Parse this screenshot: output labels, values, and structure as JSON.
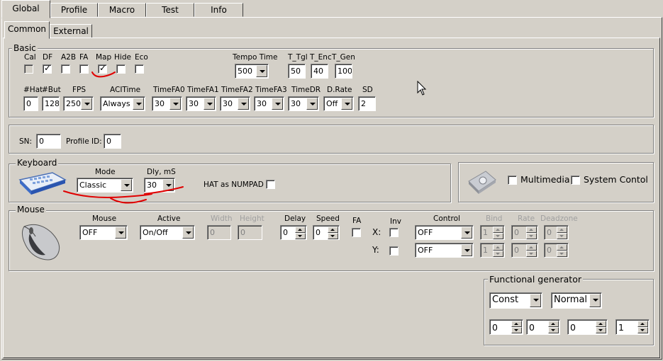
{
  "tabs_main": [
    "Global",
    "Profile",
    "Macro",
    "Test",
    "Info"
  ],
  "tabs_sub": [
    "Common",
    "External"
  ],
  "basic": {
    "title": "Basic",
    "flags": [
      {
        "label": "Cal",
        "checked": false,
        "disabled": true
      },
      {
        "label": "DF",
        "checked": true,
        "disabled": false
      },
      {
        "label": "A2B",
        "checked": false,
        "disabled": false
      },
      {
        "label": "FA",
        "checked": false,
        "disabled": false
      },
      {
        "label": "Map",
        "checked": true,
        "disabled": false
      },
      {
        "label": "Hide",
        "checked": false,
        "disabled": false
      },
      {
        "label": "Eco",
        "checked": false,
        "disabled": false
      }
    ],
    "tempo_time_label": "Tempo Time",
    "tempo_time": "500",
    "t_tgl_label": "T_Tgl",
    "t_tgl": "50",
    "t_enc_label": "T_Enc",
    "t_enc": "40",
    "t_gen_label": "T_Gen",
    "t_gen": "100",
    "hat_label": "#Hat",
    "hat": "0",
    "but_label": "#But",
    "but": "128",
    "fps_label": "FPS",
    "fps": "250",
    "acitime_label": "ACITime",
    "acitime": "Always",
    "timefa0_label": "TimeFA0",
    "timefa0": "30",
    "timefa1_label": "TimeFA1",
    "timefa1": "30",
    "timefa2_label": "TimeFA2",
    "timefa2": "30",
    "timefa3_label": "TimeFA3",
    "timefa3": "30",
    "timedr_label": "TimeDR",
    "timedr": "30",
    "drate_label": "D.Rate",
    "drate": "Off",
    "sd_label": "SD",
    "sd": "2"
  },
  "sn": {
    "sn_label": "SN:",
    "sn": "0",
    "profile_id_label": "Profile ID:",
    "profile_id": "0"
  },
  "keyboard": {
    "title": "Keyboard",
    "mode_label": "Mode",
    "mode": "Classic",
    "dly_label": "Dly, mS",
    "dly": "30",
    "hat_numpad_label": "HAT as NUMPAD"
  },
  "multimedia": {
    "multimedia_label": "Multimedia",
    "system_label": "System Contol"
  },
  "mouse": {
    "title": "Mouse",
    "mouse_label": "Mouse",
    "mouse": "OFF",
    "active_label": "Active",
    "active": "On/Off",
    "width_label": "Width",
    "width": "0",
    "height_label": "Height",
    "height": "0",
    "delay_label": "Delay",
    "delay": "0",
    "speed_label": "Speed",
    "speed": "0",
    "fa_label": "FA",
    "inv_label": "Inv",
    "x_label": "X:",
    "y_label": "Y:",
    "control_label": "Control",
    "control_x": "OFF",
    "control_y": "OFF",
    "bind_label": "Bind",
    "bind_x": "1",
    "bind_y": "1",
    "rate_label": "Rate",
    "rate_x": "0",
    "rate_y": "0",
    "deadzone_label": "Deadzone",
    "deadzone_x": "0",
    "deadzone_y": "0"
  },
  "generator": {
    "title": "Functional generator",
    "type": "Const",
    "mode": "Normal",
    "v1": "0",
    "v2": "0",
    "v3": "0",
    "v4": "1"
  },
  "colors": {
    "face": "#d4d0c8",
    "annotation": "#e00000"
  }
}
